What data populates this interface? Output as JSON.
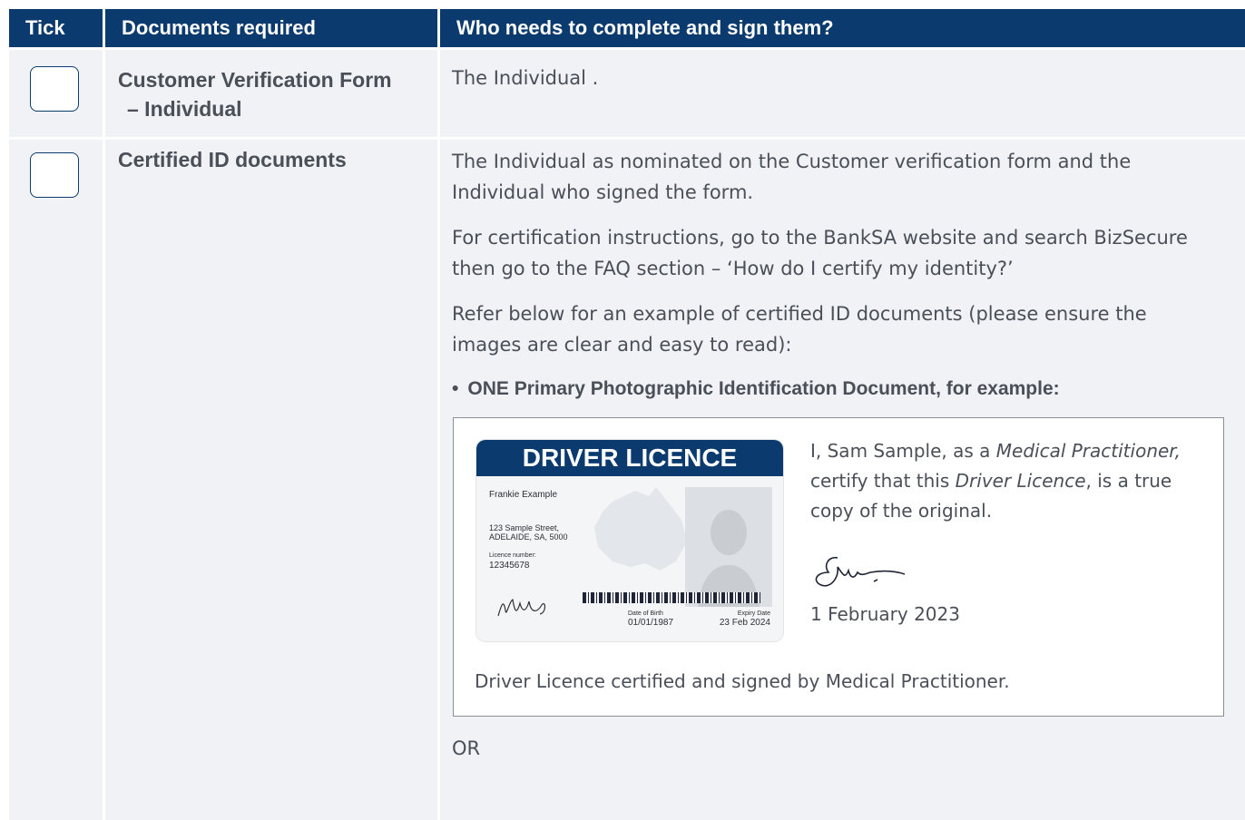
{
  "header": {
    "tick": "Tick",
    "documents": "Documents required",
    "who": "Who needs to complete and sign them?"
  },
  "rows": [
    {
      "doc_line1": "Customer Verification Form",
      "doc_line2": "– Individual",
      "who": "The Individual ."
    },
    {
      "doc": "Certified ID documents",
      "para1_line1": "The Individual as nominated on the Customer verification form and the",
      "para1_line2": "Individual who signed the form.",
      "para2_line1": "For certification instructions, go to the BankSA website and search BizSecure",
      "para2_line2": "then go to the FAQ section – ‘How do I certify my identity?’",
      "para3_line1": "Refer below for an example of certified ID documents (please ensure the",
      "para3_line2": "images are clear and easy to read):",
      "bullet": "ONE Primary Photographic Identification Document, for example:",
      "or": "OR"
    }
  ],
  "example": {
    "card_title": "DRIVER LICENCE",
    "name": "Frankie Example",
    "address_line1": "123 Sample Street,",
    "address_line2": "ADELAIDE, SA, 5000",
    "licence_label": "Licence number:",
    "licence_number": "12345678",
    "dob_label": "Date of Birth",
    "dob": "01/01/1987",
    "expiry_label": "Expiry Date",
    "expiry": "23 Feb 2024",
    "cert_prefix": "I, Sam Sample, as a ",
    "cert_role": "Medical Practitioner,",
    "cert_mid": "certify that this ",
    "cert_doc": "Driver Licence",
    "cert_suffix": ", is a true",
    "cert_line3": "copy of the original.",
    "date": "1 February 2023",
    "caption": "Driver Licence certified and signed by Medical Practitioner."
  },
  "colors": {
    "header_bg": "#0a3a6e",
    "cell_bg": "#f0f2f5",
    "text": "#4a4f58"
  }
}
